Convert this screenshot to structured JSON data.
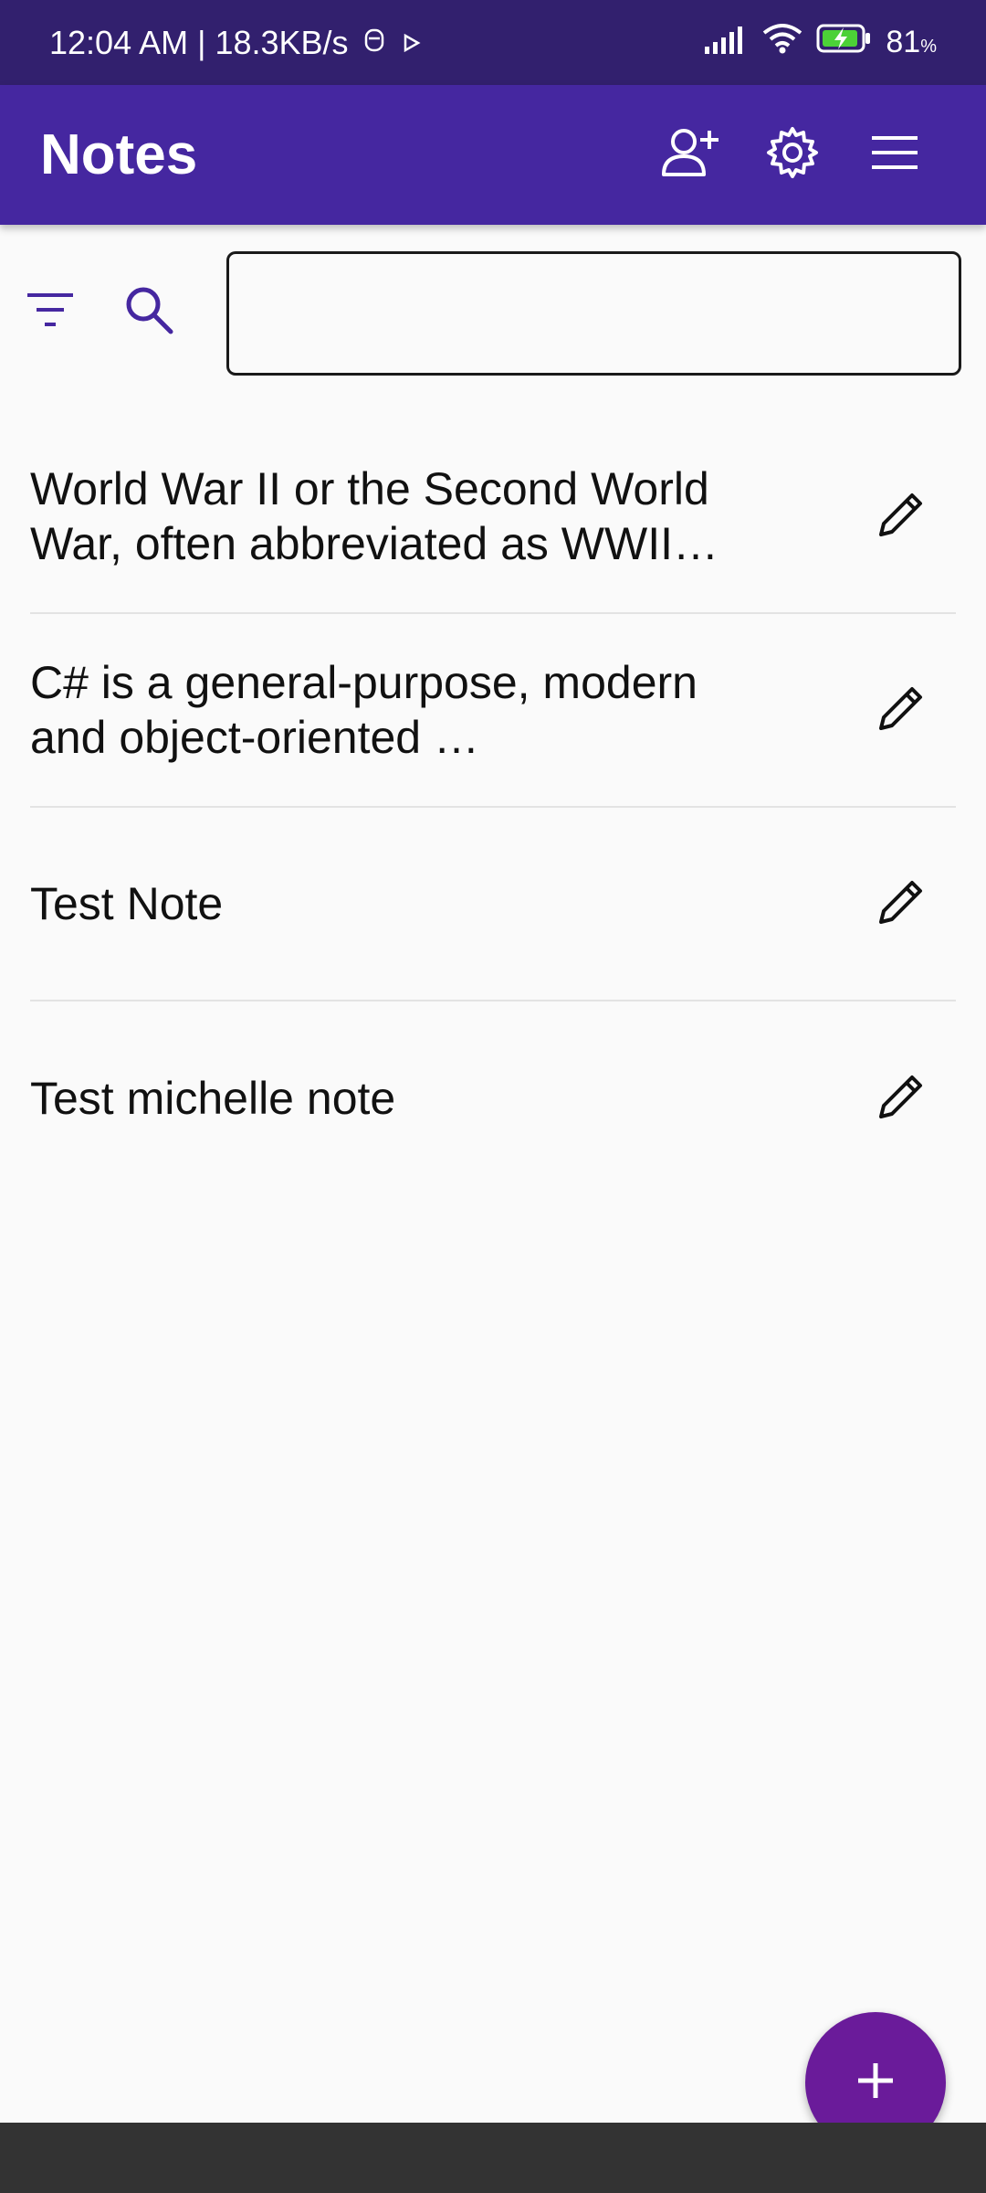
{
  "status_bar": {
    "time_speed": "12:04 AM | 18.3KB/s",
    "battery_percent": "81",
    "battery_unit": "%"
  },
  "app_bar": {
    "title": "Notes",
    "actions": [
      "add-person-icon",
      "settings-icon",
      "menu-icon"
    ]
  },
  "search": {
    "value": "",
    "placeholder": ""
  },
  "notes": [
    {
      "text": "World War II or the Second World War, often abbreviated as WWII…"
    },
    {
      "text": "C# is a general-purpose, modern and object-oriented …"
    },
    {
      "text": "Test Note"
    },
    {
      "text": "Test michelle note"
    }
  ],
  "colors": {
    "status_bar": "#32206e",
    "app_bar": "#4527a0",
    "accent": "#4527a0",
    "fab": "#6a1b9a",
    "background": "#fafafa"
  }
}
